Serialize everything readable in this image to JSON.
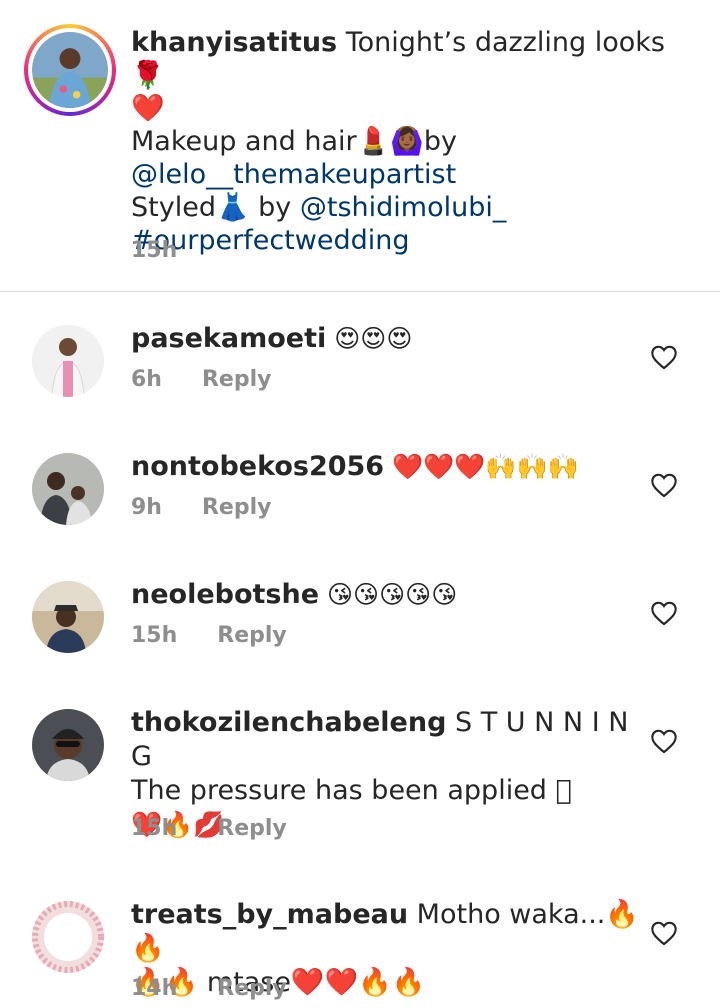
{
  "caption": {
    "username": "khanyisatitus",
    "text_line1": " Tonight’s dazzling looks 🌹",
    "text_line2": "❤️",
    "text_line3_pre": "Makeup and hair💄🙆🏾‍♀️by",
    "mention1": "@lelo__themakeupartist",
    "text_line5_pre": "Styled👗 by ",
    "mention2": "@tshidimolubi_",
    "hashtag": "#ourperfectwedding",
    "time": "15h"
  },
  "comments": [
    {
      "username": "pasekamoeti",
      "text": " 😍😍😍",
      "time": "6h",
      "reply": "Reply"
    },
    {
      "username": "nontobekos2056",
      "text": " ❤️❤️❤️🙌🙌🙌",
      "time": "9h",
      "reply": "Reply"
    },
    {
      "username": "neolebotshe",
      "text": " 😘😘😘😘😘",
      "time": "15h",
      "reply": "Reply"
    },
    {
      "username": "thokozilenchabeleng",
      "text": " S T U N N I N G",
      "text2": "The pressure has been applied 🏾",
      "text3": "❤️🔥💋",
      "time": "15h",
      "reply": "Reply"
    },
    {
      "username": "treats_by_mabeau",
      "text": " Motho waka...🔥🔥",
      "text2": "🔥🔥 mtase❤️❤️🔥🔥",
      "time": "14h",
      "reply": "Reply"
    }
  ],
  "colors": {
    "text": "#262626",
    "meta": "#8e8e8e",
    "link": "#00376b",
    "divider": "#dbdbdb"
  },
  "icons": {
    "like": "heart-outline-icon"
  }
}
